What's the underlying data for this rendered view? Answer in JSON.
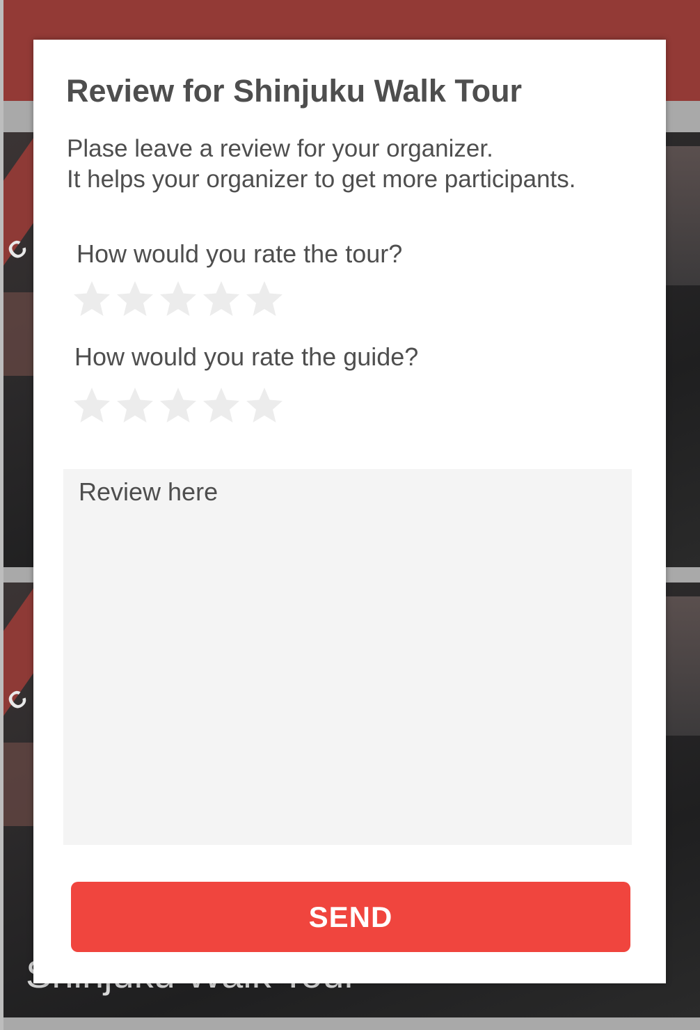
{
  "modal": {
    "title": "Review for Shinjuku Walk Tour",
    "intro_lines": [
      "Plase leave a review for your organizer.",
      "It helps your organizer to get more participants."
    ],
    "questions": [
      {
        "label": "How would you rate the tour?",
        "rating": 0,
        "max": 5
      },
      {
        "label": "How would you rate the guide?",
        "rating": 0,
        "max": 5
      }
    ],
    "review_placeholder": "Review here",
    "send_label": "SEND"
  },
  "background": {
    "card_title": "Shinjuku Walk Tour",
    "ribbon_fragment": "C"
  },
  "colors": {
    "header": "#933a36",
    "send_button": "#f0453e",
    "star_empty": "#ececec",
    "text": "#4e4e4e",
    "review_bg": "#f4f4f4"
  },
  "icons": {
    "rating_star": "star-icon"
  }
}
